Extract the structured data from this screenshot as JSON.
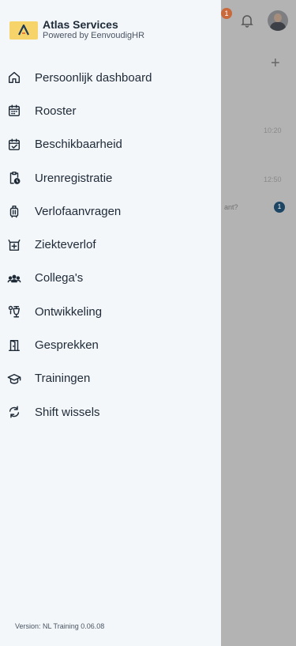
{
  "background": {
    "notification_count": "1",
    "time1": "10:20",
    "time2": "12:50",
    "snippet": "ant?",
    "unread_count": "1"
  },
  "brand": {
    "title": "Atlas Services",
    "subtitle": "Powered by EenvoudigHR"
  },
  "menu": [
    {
      "label": "Persoonlijk dashboard",
      "icon": "home-icon"
    },
    {
      "label": "Rooster",
      "icon": "calendar-icon"
    },
    {
      "label": "Beschikbaarheid",
      "icon": "calendar-check-icon"
    },
    {
      "label": "Urenregistratie",
      "icon": "clipboard-clock-icon"
    },
    {
      "label": "Verlofaanvragen",
      "icon": "suitcase-icon"
    },
    {
      "label": "Ziekteverlof",
      "icon": "medical-cross-icon"
    },
    {
      "label": "Collega's",
      "icon": "users-icon"
    },
    {
      "label": "Ontwikkeling",
      "icon": "development-icon"
    },
    {
      "label": "Gesprekken",
      "icon": "door-icon"
    },
    {
      "label": "Trainingen",
      "icon": "graduation-cap-icon"
    },
    {
      "label": "Shift wissels",
      "icon": "swap-icon"
    }
  ],
  "version": "Version: NL Training 0.06.08",
  "colors": {
    "drawer": "#f3f7fa",
    "logo": "#f7d469",
    "text": "#1f2a37"
  }
}
